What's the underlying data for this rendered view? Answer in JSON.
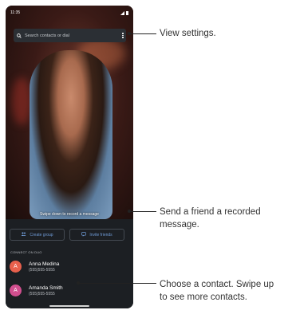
{
  "status_bar": {
    "time": "11:35"
  },
  "search": {
    "placeholder": "Search contacts or dial"
  },
  "video": {
    "hint": "Swipe down to record a message"
  },
  "actions": {
    "create_group": "Create group",
    "invite_friends": "Invite friends"
  },
  "section_title": "CONNECT ON DUO",
  "contacts": [
    {
      "initial": "A",
      "name": "Anna Medina",
      "number": "(555)555-5555",
      "color": "#e8604c"
    },
    {
      "initial": "A",
      "name": "Amanda Smith",
      "number": "(555)555-5555",
      "color": "#d14f8f"
    }
  ],
  "callouts": {
    "settings": "View settings.",
    "record_line1": "Send a friend a recorded",
    "record_line2": "message.",
    "contact_line1": "Choose a contact. Swipe up",
    "contact_line2": "to see more contacts."
  },
  "icons": [
    "search-icon",
    "more-vert-icon",
    "group-icon",
    "message-icon",
    "signal-icon",
    "battery-icon"
  ],
  "colors": {
    "accent": "#6f9bd6",
    "panel": "#1c1f23"
  }
}
